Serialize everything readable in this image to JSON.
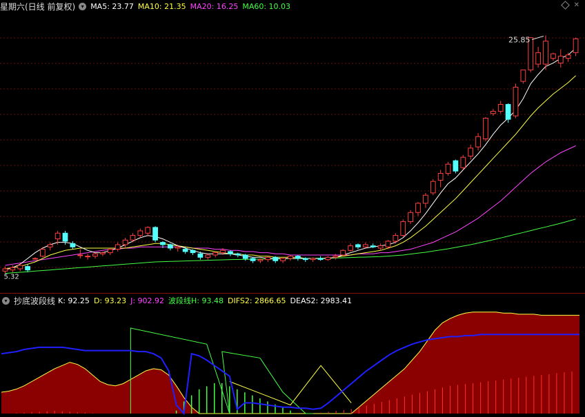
{
  "top": {
    "title": "星期六(日线 前复权)",
    "ma": [
      {
        "label": "MA5: 23.77",
        "color": "#ffffff"
      },
      {
        "label": "MA10: 21.35",
        "color": "#ffff44"
      },
      {
        "label": "MA20: 16.25",
        "color": "#ff44ff"
      },
      {
        "label": "MA60: 10.03",
        "color": "#44ff44"
      }
    ],
    "high_label": "25.85",
    "low_label": "5.32"
  },
  "bottom": {
    "title": "抄底波段线",
    "items": [
      {
        "label": "K: 92.25",
        "color": "#ffffff"
      },
      {
        "label": "D: 93.23",
        "color": "#ffff44"
      },
      {
        "label": "J: 902.92",
        "color": "#ff44ff"
      },
      {
        "label": "波段线H: 93.48",
        "color": "#44ff44"
      },
      {
        "label": "DIFS2: 2866.65",
        "color": "#ffff44"
      },
      {
        "label": "DEAS2: 2983.41",
        "color": "#ffffff"
      }
    ]
  },
  "chart_data": {
    "type": "candlestick",
    "ylim": [
      4.5,
      28
    ],
    "up_color": "#ff4040",
    "down_color": "#54ffff",
    "candles": [
      [
        5.5,
        5.7,
        5.3,
        5.9
      ],
      [
        5.6,
        5.8,
        5.4,
        6.0
      ],
      [
        5.7,
        6.0,
        5.5,
        6.2
      ],
      [
        5.9,
        5.6,
        5.4,
        6.1
      ],
      [
        6.6,
        6.6,
        6.5,
        6.7
      ],
      [
        6.8,
        7.4,
        6.7,
        7.6
      ],
      [
        7.6,
        7.8,
        7.3,
        8.0
      ],
      [
        8.3,
        8.8,
        7.8,
        9.0
      ],
      [
        8.8,
        8.1,
        7.8,
        9.0
      ],
      [
        7.9,
        7.6,
        7.4,
        8.1
      ],
      [
        6.9,
        6.9,
        6.6,
        7.4
      ],
      [
        6.8,
        6.8,
        6.5,
        7.0
      ],
      [
        6.8,
        7.0,
        6.6,
        7.1
      ],
      [
        7.0,
        7.1,
        6.8,
        7.2
      ],
      [
        7.1,
        7.4,
        6.9,
        7.5
      ],
      [
        7.4,
        7.8,
        7.2,
        8.0
      ],
      [
        7.8,
        8.2,
        7.5,
        8.4
      ],
      [
        8.2,
        8.6,
        8.0,
        8.8
      ],
      [
        8.6,
        9.0,
        8.4,
        9.2
      ],
      [
        8.8,
        9.3,
        8.5,
        9.4
      ],
      [
        9.3,
        8.2,
        8.0,
        9.4
      ],
      [
        8.0,
        7.8,
        7.5,
        8.1
      ],
      [
        7.8,
        7.5,
        7.3,
        7.9
      ],
      [
        7.5,
        7.6,
        7.2,
        7.8
      ],
      [
        7.4,
        7.2,
        7.0,
        7.6
      ],
      [
        7.3,
        7.1,
        6.9,
        7.4
      ],
      [
        7.0,
        6.7,
        6.5,
        7.2
      ],
      [
        6.7,
        6.9,
        6.5,
        7.0
      ],
      [
        6.9,
        7.1,
        6.7,
        7.2
      ],
      [
        7.1,
        7.3,
        6.9,
        7.5
      ],
      [
        7.2,
        7.0,
        6.8,
        7.3
      ],
      [
        7.0,
        6.9,
        6.7,
        7.1
      ],
      [
        6.9,
        6.6,
        6.4,
        7.0
      ],
      [
        6.6,
        6.4,
        6.2,
        6.7
      ],
      [
        6.4,
        6.5,
        6.2,
        6.6
      ],
      [
        6.5,
        6.7,
        6.3,
        6.8
      ],
      [
        6.7,
        6.4,
        6.2,
        6.8
      ],
      [
        6.4,
        6.6,
        6.2,
        6.7
      ],
      [
        6.6,
        6.8,
        6.4,
        6.9
      ],
      [
        6.8,
        6.6,
        6.4,
        6.9
      ],
      [
        6.6,
        6.5,
        6.3,
        6.7
      ],
      [
        6.5,
        6.6,
        6.3,
        6.7
      ],
      [
        6.6,
        6.5,
        6.4,
        6.8
      ],
      [
        6.5,
        6.7,
        6.4,
        6.8
      ],
      [
        6.7,
        6.8,
        6.5,
        7.0
      ],
      [
        6.9,
        7.3,
        6.8,
        7.4
      ],
      [
        7.3,
        7.7,
        7.2,
        7.9
      ],
      [
        7.8,
        7.6,
        7.4,
        7.9
      ],
      [
        7.6,
        7.8,
        7.5,
        8.0
      ],
      [
        7.7,
        7.6,
        7.5,
        7.9
      ],
      [
        7.5,
        7.7,
        7.3,
        7.9
      ],
      [
        7.6,
        8.1,
        7.4,
        8.2
      ],
      [
        8.1,
        8.6,
        7.9,
        8.8
      ],
      [
        8.6,
        9.8,
        8.5,
        10.0
      ],
      [
        9.8,
        10.6,
        9.6,
        10.8
      ],
      [
        10.6,
        11.4,
        10.3,
        11.5
      ],
      [
        11.4,
        12.1,
        11.0,
        12.3
      ],
      [
        12.3,
        13.3,
        12.1,
        13.5
      ],
      [
        13.4,
        14.0,
        12.8,
        14.3
      ],
      [
        14.0,
        14.8,
        13.8,
        15.0
      ],
      [
        15.1,
        14.2,
        14.0,
        15.2
      ],
      [
        14.5,
        15.4,
        14.3,
        15.6
      ],
      [
        15.5,
        16.2,
        15.2,
        16.5
      ],
      [
        16.3,
        17.2,
        16.0,
        17.5
      ],
      [
        17.0,
        18.8,
        16.8,
        18.9
      ],
      [
        19.2,
        19.4,
        19.0,
        19.6
      ],
      [
        19.4,
        20.0,
        19.2,
        20.3
      ],
      [
        20.0,
        18.7,
        18.4,
        20.1
      ],
      [
        19.0,
        21.5,
        18.8,
        21.8
      ],
      [
        22.0,
        23.0,
        21.8,
        23.0
      ],
      [
        23.0,
        25.8,
        22.8,
        25.85
      ],
      [
        23.5,
        24.5,
        23.2,
        25.0
      ],
      [
        23.5,
        25.5,
        23.0,
        26.0
      ],
      [
        24.0,
        24.4,
        23.8,
        24.5
      ],
      [
        23.6,
        24.2,
        23.2,
        24.8
      ],
      [
        24.0,
        24.3,
        23.7,
        24.5
      ],
      [
        24.5,
        25.7,
        24.2,
        25.8
      ]
    ],
    "ma5": [
      5.6,
      5.8,
      6.1,
      6.6,
      7.1,
      7.5,
      7.8,
      8.0,
      8.0,
      7.9,
      7.6,
      7.3,
      7.1,
      7.1,
      7.3,
      7.5,
      7.8,
      8.1,
      8.4,
      8.6,
      8.5,
      8.3,
      8.0,
      7.7,
      7.5,
      7.3,
      7.1,
      7.0,
      7.0,
      7.0,
      7.0,
      6.9,
      6.8,
      6.7,
      6.7,
      6.6,
      6.6,
      6.6,
      6.6,
      6.6,
      6.6,
      6.6,
      6.6,
      6.6,
      6.7,
      6.9,
      7.1,
      7.3,
      7.5,
      7.6,
      7.7,
      7.8,
      8.0,
      8.4,
      9.0,
      9.7,
      10.5,
      11.4,
      12.3,
      13.1,
      13.6,
      14.3,
      15.0,
      15.7,
      16.5,
      17.4,
      18.2,
      18.8,
      19.5,
      20.5,
      21.8,
      22.6,
      23.3,
      23.6,
      24.0,
      24.3,
      24.9
    ],
    "ma10": [
      5.7,
      5.8,
      5.9,
      6.1,
      6.3,
      6.6,
      6.9,
      7.1,
      7.3,
      7.4,
      7.5,
      7.5,
      7.5,
      7.5,
      7.5,
      7.5,
      7.5,
      7.6,
      7.7,
      7.8,
      7.9,
      7.9,
      7.8,
      7.7,
      7.6,
      7.5,
      7.4,
      7.3,
      7.2,
      7.1,
      7.0,
      7.0,
      6.9,
      6.9,
      6.8,
      6.8,
      6.7,
      6.7,
      6.7,
      6.7,
      6.6,
      6.6,
      6.6,
      6.6,
      6.7,
      6.8,
      6.9,
      7.0,
      7.1,
      7.2,
      7.3,
      7.5,
      7.7,
      8.0,
      8.4,
      8.9,
      9.4,
      10.0,
      10.6,
      11.2,
      11.8,
      12.5,
      13.2,
      13.9,
      14.6,
      15.3,
      16.0,
      16.7,
      17.4,
      18.2,
      19.0,
      19.7,
      20.3,
      20.9,
      21.4,
      21.9,
      22.5
    ],
    "ma20": [
      6.0,
      6.1,
      6.2,
      6.3,
      6.4,
      6.5,
      6.6,
      6.7,
      6.8,
      6.9,
      7.0,
      7.1,
      7.2,
      7.3,
      7.4,
      7.4,
      7.5,
      7.5,
      7.6,
      7.6,
      7.6,
      7.6,
      7.6,
      7.6,
      7.6,
      7.5,
      7.5,
      7.5,
      7.4,
      7.4,
      7.3,
      7.3,
      7.2,
      7.2,
      7.1,
      7.1,
      7.0,
      7.0,
      6.9,
      6.9,
      6.9,
      6.9,
      6.9,
      6.9,
      6.9,
      6.9,
      6.9,
      7.0,
      7.0,
      7.0,
      7.1,
      7.1,
      7.2,
      7.3,
      7.4,
      7.6,
      7.8,
      8.0,
      8.3,
      8.6,
      8.9,
      9.3,
      9.7,
      10.1,
      10.6,
      11.1,
      11.6,
      12.2,
      12.8,
      13.4,
      14.0,
      14.5,
      15.0,
      15.4,
      15.8,
      16.1,
      16.4
    ],
    "ma60": [
      5.3,
      5.35,
      5.4,
      5.45,
      5.5,
      5.55,
      5.6,
      5.65,
      5.7,
      5.75,
      5.8,
      5.85,
      5.9,
      5.95,
      6.0,
      6.05,
      6.1,
      6.15,
      6.2,
      6.25,
      6.3,
      6.32,
      6.34,
      6.36,
      6.38,
      6.4,
      6.42,
      6.44,
      6.46,
      6.48,
      6.5,
      6.51,
      6.52,
      6.53,
      6.54,
      6.55,
      6.56,
      6.57,
      6.58,
      6.59,
      6.6,
      6.61,
      6.62,
      6.63,
      6.64,
      6.66,
      6.68,
      6.7,
      6.72,
      6.74,
      6.76,
      6.8,
      6.85,
      6.9,
      6.98,
      7.06,
      7.14,
      7.24,
      7.34,
      7.44,
      7.56,
      7.68,
      7.8,
      7.94,
      8.08,
      8.22,
      8.38,
      8.54,
      8.7,
      8.86,
      9.02,
      9.18,
      9.34,
      9.5,
      9.66,
      9.84,
      10.03
    ],
    "indicator": {
      "ylim": [
        0,
        100
      ],
      "fill": [
        20,
        21,
        23,
        26,
        30,
        34,
        38,
        42,
        45,
        48,
        46,
        42,
        36,
        30,
        27,
        26,
        28,
        32,
        36,
        40,
        42,
        41,
        36,
        26,
        15,
        6,
        0,
        0,
        0,
        0,
        0,
        0,
        0,
        0,
        0,
        0,
        0,
        0,
        0,
        0,
        0,
        0,
        0,
        0,
        0,
        0,
        0,
        6,
        12,
        18,
        24,
        30,
        36,
        42,
        50,
        58,
        68,
        78,
        85,
        89,
        92,
        94,
        95,
        95,
        95,
        95,
        94,
        94,
        93,
        93,
        93,
        92,
        92,
        92,
        92,
        92,
        92
      ],
      "blue": [
        56,
        57,
        58,
        60,
        61,
        62,
        62,
        62,
        62,
        61,
        60,
        59,
        59,
        59,
        59,
        59,
        59,
        59,
        58,
        58,
        56,
        52,
        40,
        8,
        0,
        56,
        54,
        50,
        45,
        40,
        35,
        4,
        10,
        10,
        9,
        8,
        7,
        6,
        6,
        5,
        5,
        4,
        5,
        10,
        16,
        22,
        28,
        34,
        40,
        45,
        50,
        55,
        59,
        62,
        65,
        67,
        69,
        70,
        71,
        72,
        72,
        73,
        73,
        74,
        74,
        74,
        74,
        74,
        74,
        74,
        74,
        74,
        74,
        74,
        74,
        74,
        74
      ],
      "green_poly": [
        [
          17,
          0
        ],
        [
          17,
          80
        ],
        [
          27,
          65
        ],
        [
          30,
          0
        ],
        [
          29,
          58
        ],
        [
          34,
          52
        ],
        [
          37,
          20
        ],
        [
          40,
          0
        ],
        [
          41,
          0
        ]
      ],
      "yellow_poly": [
        [
          30,
          30
        ],
        [
          38,
          8
        ],
        [
          42,
          45
        ],
        [
          46,
          10
        ]
      ],
      "bars": [
        0,
        0,
        1,
        2,
        3,
        4,
        5,
        6,
        5,
        4,
        3,
        2,
        1,
        0,
        0,
        0,
        0,
        0,
        0,
        0,
        0,
        0,
        0,
        -2,
        -8,
        -12,
        -16,
        -18,
        -20,
        -20,
        -18,
        -16,
        -14,
        -12,
        -10,
        -8,
        -6,
        -4,
        -2,
        0,
        0,
        0,
        2,
        4,
        6,
        8,
        10,
        14,
        18,
        22,
        26,
        30,
        34,
        38,
        42,
        46,
        50,
        54,
        58,
        62,
        64,
        66,
        68,
        70,
        72,
        74,
        76,
        78,
        80,
        82,
        84,
        86,
        88,
        90,
        92,
        94
      ]
    }
  }
}
